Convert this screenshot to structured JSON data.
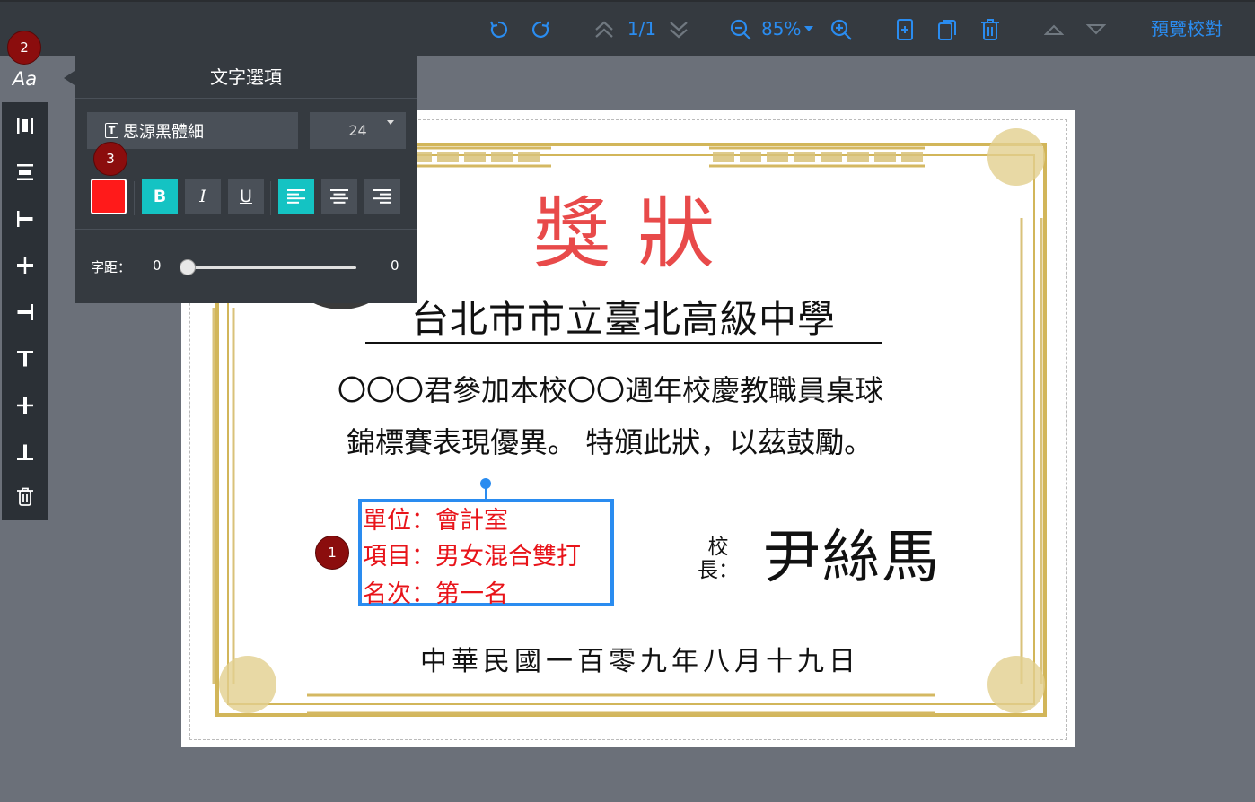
{
  "toolbar": {
    "page_indicator": "1/1",
    "zoom_level": "85%",
    "preview_label": "預覽校對"
  },
  "side_tools": {
    "text_tool_label": "Aa"
  },
  "badges": {
    "badge_1": "1",
    "badge_2": "2",
    "badge_3": "3"
  },
  "text_panel": {
    "title": "文字選項",
    "font_icon": "T",
    "font_name": "思源黑體細",
    "font_size": "24",
    "text_color": "#ff1a1a",
    "bold_label": "B",
    "italic_label": "I",
    "underline_label": "U",
    "spacing_label": "字距：",
    "spacing_value": "0",
    "spacing_max_value": "0"
  },
  "certificate": {
    "title": "獎狀",
    "school": "台北市市立臺北高級中學",
    "line1": "〇〇〇君參加本校〇〇週年校慶教職員桌球",
    "line2": "錦標賽表現優異。 特頒此狀，以茲鼓勵。",
    "unit_line": "單位：會計室",
    "item_line": "項目：男女混合雙打",
    "rank_line": "名次：第一名",
    "principal_label": "校長：",
    "principal_name": "尹絲馬",
    "date": "中華民國一百零九年八月十九日"
  },
  "colors": {
    "accent": "#2a8cf0",
    "title_red": "#e84a4a",
    "active_teal": "#14c3c3",
    "badge_red": "#8b0d0d"
  }
}
